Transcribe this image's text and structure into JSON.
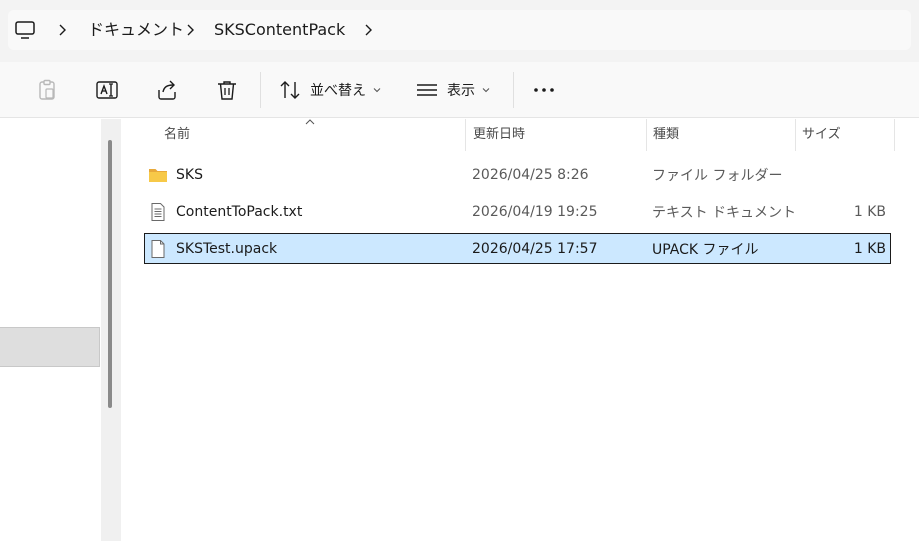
{
  "address": {
    "root_icon": "computer-icon",
    "crumbs": [
      "ドキュメント",
      "SKSContentPack"
    ]
  },
  "toolbar": {
    "paste_icon": "paste-icon",
    "rename_icon": "rename-icon",
    "share_icon": "share-icon",
    "delete_icon": "delete-icon",
    "sort_label": "並べ替え",
    "view_label": "表示",
    "more_icon": "more-icon"
  },
  "columns": {
    "name": "名前",
    "modified": "更新日時",
    "type": "種類",
    "size": "サイズ"
  },
  "files": [
    {
      "icon": "folder-icon",
      "name": "SKS",
      "modified": "2026/04/25 8:26",
      "type": "ファイル フォルダー",
      "size": "",
      "selected": false
    },
    {
      "icon": "text-file-icon",
      "name": "ContentToPack.txt",
      "modified": "2026/04/19 19:25",
      "type": "テキスト ドキュメント",
      "size": "1 KB",
      "selected": false
    },
    {
      "icon": "file-icon",
      "name": "SKSTest.upack",
      "modified": "2026/04/25 17:57",
      "type": "UPACK ファイル",
      "size": "1 KB",
      "selected": true
    }
  ],
  "colors": {
    "selection": "#cce8ff",
    "folder": "#f4c542"
  }
}
